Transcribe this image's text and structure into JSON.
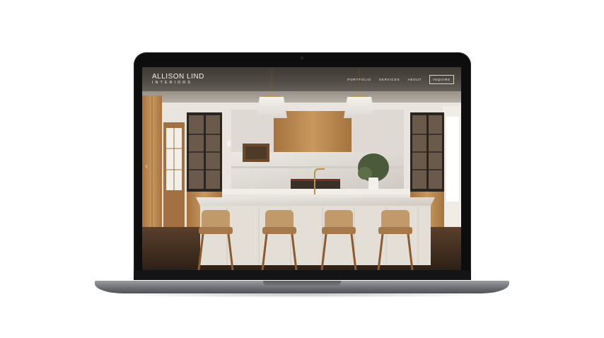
{
  "site": {
    "logo_main": "ALLISON LIND",
    "logo_sub": "INTERIORS",
    "nav": {
      "portfolio": "PORTFOLIO",
      "services": "SERVICES",
      "about": "ABOUT",
      "inquire": "INQUIRE"
    }
  },
  "icons": {
    "prev": "chevron-left-icon",
    "next": "chevron-right-icon"
  },
  "colors": {
    "frame": "#0d0d0e",
    "chassis": "#6e7075",
    "wood": "#b98a57",
    "marble": "#e6e2dc",
    "floor": "#3b2a1e"
  }
}
